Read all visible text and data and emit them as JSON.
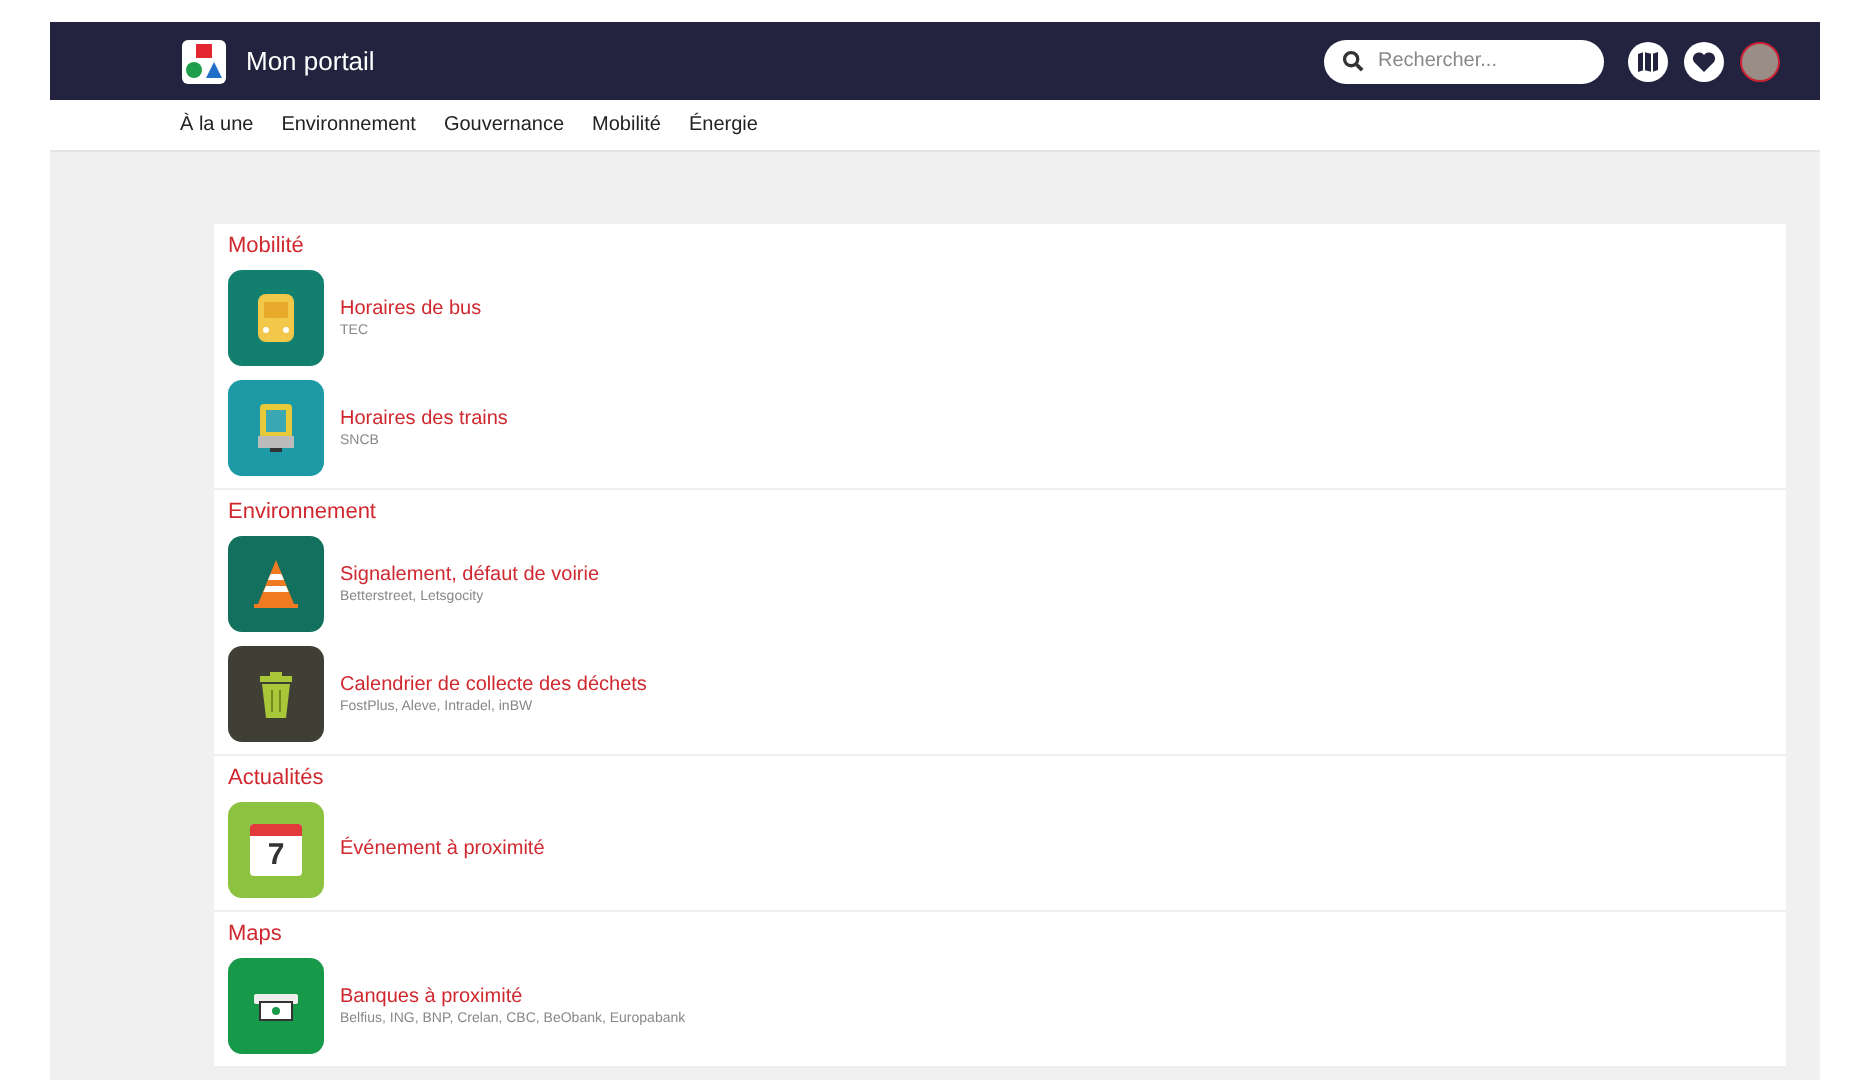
{
  "header": {
    "title": "Mon portail",
    "search": {
      "placeholder": "Rechercher..."
    }
  },
  "nav": [
    {
      "label": "À la une"
    },
    {
      "label": "Environnement"
    },
    {
      "label": "Gouvernance"
    },
    {
      "label": "Mobilité"
    },
    {
      "label": "Énergie"
    }
  ],
  "sections": [
    {
      "title": "Mobilité",
      "items": [
        {
          "kind": "bus",
          "title": "Horaires de bus",
          "subtitle": "TEC"
        },
        {
          "kind": "train",
          "title": "Horaires des trains",
          "subtitle": "SNCB"
        }
      ]
    },
    {
      "title": "Environnement",
      "items": [
        {
          "kind": "cone",
          "title": "Signalement, défaut de voirie",
          "subtitle": "Betterstreet, Letsgocity"
        },
        {
          "kind": "bin",
          "title": "Calendrier de collecte des déchets",
          "subtitle": "FostPlus, Aleve, Intradel, inBW"
        }
      ]
    },
    {
      "title": "Actualités",
      "items": [
        {
          "kind": "calendar",
          "title": "Événement à proximité",
          "day": "7"
        }
      ]
    },
    {
      "title": "Maps",
      "items": [
        {
          "kind": "bank",
          "title": "Banques à proximité",
          "subtitle": "Belfius, ING, BNP, Crelan, CBC, BeObank, Europabank"
        }
      ]
    }
  ]
}
